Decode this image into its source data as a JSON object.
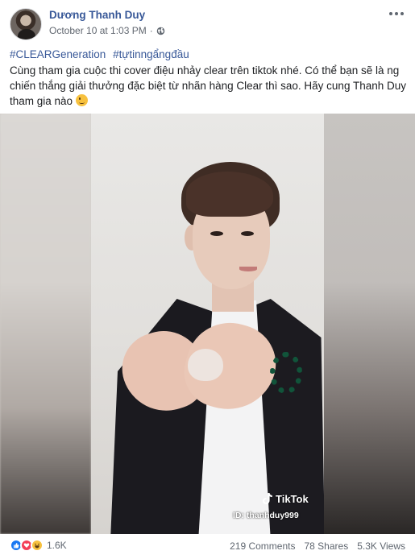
{
  "post": {
    "author": "Dương Thanh Duy",
    "timestamp": "October 10 at 1:03 PM",
    "hashtags": [
      "#CLEARGeneration",
      "#tựtinngẩngđầu"
    ],
    "body": "Cùng tham gia cuộc thi cover điệu nhảy clear trên tiktok nhé. Có thể bạn sẽ là ng chiến thắng giải thưởng đặc biệt từ nhãn hàng Clear thì sao. Hãy cung Thanh Duy tham gia nào",
    "privacy_icon": "globe-icon",
    "menu_icon": "more-icon"
  },
  "video": {
    "watermark": "TikTok",
    "user_id": "ID: thanhduy999"
  },
  "footer": {
    "reaction_icons": [
      "like-icon",
      "love-icon",
      "haha-icon"
    ],
    "reaction_count": "1.6K",
    "comments": "219 Comments",
    "shares": "78 Shares",
    "views": "5.3K Views"
  },
  "colors": {
    "link": "#385898",
    "like": "#1877f2",
    "love": "#f33e58",
    "haha": "#f7c13e"
  }
}
